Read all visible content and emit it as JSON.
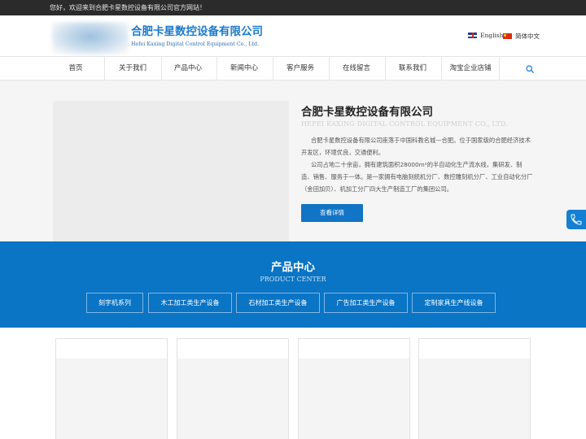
{
  "topbar": {
    "greeting": "您好，欢迎来到合肥卡星数控设备有限公司官方网站！"
  },
  "header": {
    "company_name": "合肥卡星数控设备有限公司",
    "company_name_en": "Hefei Kaxing Digital Control Equipment Co., Ltd.",
    "languages": [
      {
        "label": "English",
        "flag": "uk-flag"
      },
      {
        "label": "简体中文",
        "flag": "cn-flag"
      }
    ]
  },
  "nav": {
    "items": [
      "首页",
      "关于我们",
      "产品中心",
      "新闻中心",
      "客户服务",
      "在线留言",
      "联系我们",
      "淘宝企业店铺"
    ],
    "search_icon": "search-icon"
  },
  "about": {
    "title": "合肥卡星数控设备有限公司",
    "title_en": "HEFEI KAXING DIGITAL CONTROL EQUIPMENT CO., LTD.",
    "paragraph_1": "合肥卡星数控设备有限公司座落于中国科教名城—合肥。位于国家级的合肥经济技术开发区，环境优良，交通便利。",
    "paragraph_2": "公司占地二十余亩，拥有建筑面积28000m²的半自动化生产流水线，集研发、制造、销售、服务于一体。是一家拥有电脑刻统机分厂、数控雕刻机分厂、工业自动化分厂（金田加贝）、机加工分厂四大生产制造工厂的集团公司。",
    "more_label": "查看详情"
  },
  "products": {
    "title": "产品中心",
    "title_en": "PRODUCT CENTER",
    "categories": [
      "刻字机系列",
      "木工加工类生产设备",
      "石材加工类生产设备",
      "广告加工类生产设备",
      "定制家具生产线设备"
    ]
  },
  "side": {
    "phone_icon": "phone-icon"
  },
  "colors": {
    "accent": "#0a74c5",
    "brand_text": "#1a7acb",
    "topbar": "#2b2b2b"
  }
}
